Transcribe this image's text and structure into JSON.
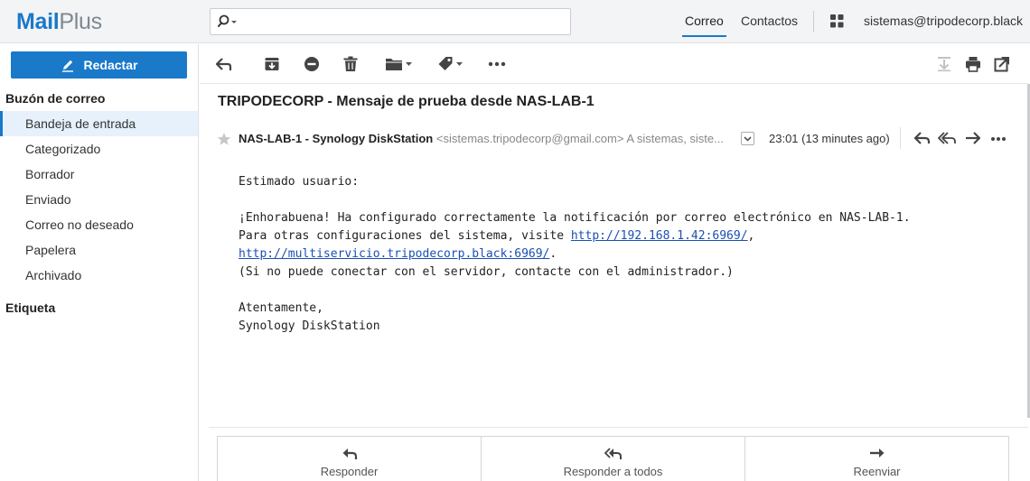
{
  "app": {
    "logo_primary": "Mail",
    "logo_secondary": "Plus",
    "brand_color": "#1a79c9"
  },
  "topbar": {
    "search": {
      "value": "",
      "placeholder": "",
      "icon": "search-icon"
    },
    "tabs": [
      {
        "label": "Correo",
        "active": true
      },
      {
        "label": "Contactos",
        "active": false
      }
    ],
    "apps_icon": "apps-grid-icon",
    "account": "sistemas@tripodecorp.black"
  },
  "sidebar": {
    "compose_label": "Redactar",
    "mailbox_heading": "Buzón de correo",
    "folders": [
      {
        "label": "Bandeja de entrada",
        "selected": true
      },
      {
        "label": "Categorizado",
        "selected": false
      },
      {
        "label": "Borrador",
        "selected": false
      },
      {
        "label": "Enviado",
        "selected": false
      },
      {
        "label": "Correo no deseado",
        "selected": false
      },
      {
        "label": "Papelera",
        "selected": false
      },
      {
        "label": "Archivado",
        "selected": false
      }
    ],
    "labels_heading": "Etiqueta"
  },
  "toolbar": {
    "left_icons": [
      "back-arrow-icon",
      "archive-icon",
      "block-icon",
      "trash-icon",
      "folder-icon",
      "tag-icon",
      "more-icon"
    ],
    "right_icons": [
      "download-icon",
      "print-icon",
      "open-window-icon"
    ]
  },
  "message": {
    "subject": "TRIPODECORP - Mensaje de prueba desde NAS-LAB-1",
    "sender_name": "NAS-LAB-1 - Synology DiskStation",
    "sender_address": "<sistemas.tripodecorp@gmail.com>",
    "recipients": "A sistemas, siste...",
    "time": "23:01 (13 minutes ago)",
    "body": {
      "greeting": "Estimado usuario:",
      "line1": "¡Enhorabuena! Ha configurado correctamente la notificación por correo electrónico en NAS-LAB-1.",
      "line2_prefix": "Para otras configuraciones del sistema, visite ",
      "link1": "http://192.168.1.42:6969/",
      "line2_suffix": ",",
      "link2": "http://multiservicio.tripodecorp.black:6969/",
      "line3_suffix": ".",
      "line4": "(Si no puede conectar con el servidor, contacte con el administrador.)",
      "closing": "Atentamente,",
      "signature": "Synology DiskStation"
    }
  },
  "reply_bar": {
    "reply": "Responder",
    "reply_all": "Responder a todos",
    "forward": "Reenviar"
  }
}
